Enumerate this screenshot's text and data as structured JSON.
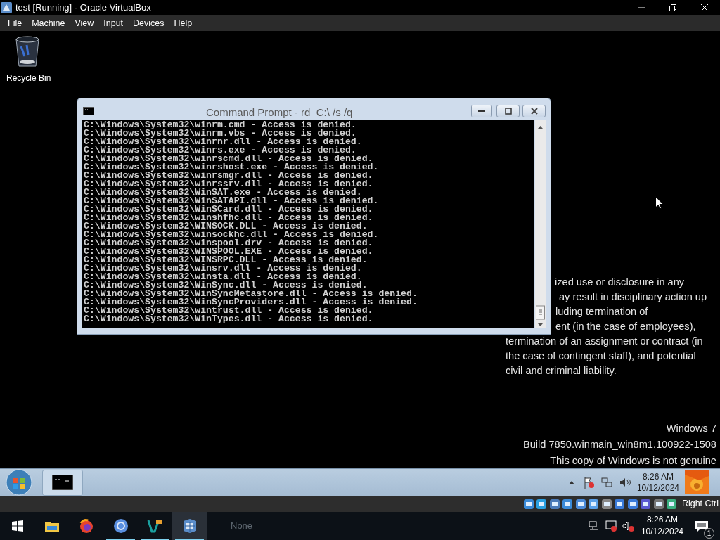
{
  "window": {
    "title": "test [Running] - Oracle VirtualBox"
  },
  "menu": [
    "File",
    "Machine",
    "View",
    "Input",
    "Devices",
    "Help"
  ],
  "desktop": {
    "icons": [
      {
        "label": "Recycle Bin"
      }
    ],
    "console_window": {
      "title": "Command Prompt - rd  C:\\ /s /q",
      "lines": [
        "C:\\Windows\\System32\\winrm.cmd - Access is denied.",
        "C:\\Windows\\System32\\winrm.vbs - Access is denied.",
        "C:\\Windows\\System32\\winrnr.dll - Access is denied.",
        "C:\\Windows\\System32\\winrs.exe - Access is denied.",
        "C:\\Windows\\System32\\winrscmd.dll - Access is denied.",
        "C:\\Windows\\System32\\winrshost.exe - Access is denied.",
        "C:\\Windows\\System32\\winrsmgr.dll - Access is denied.",
        "C:\\Windows\\System32\\winrssrv.dll - Access is denied.",
        "C:\\Windows\\System32\\WinSAT.exe - Access is denied.",
        "C:\\Windows\\System32\\WinSATAPI.dll - Access is denied.",
        "C:\\Windows\\System32\\WinSCard.dll - Access is denied.",
        "C:\\Windows\\System32\\winshfhc.dll - Access is denied.",
        "C:\\Windows\\System32\\WINSOCK.DLL - Access is denied.",
        "C:\\Windows\\System32\\winsockhc.dll - Access is denied.",
        "C:\\Windows\\System32\\winspool.drv - Access is denied.",
        "C:\\Windows\\System32\\WINSPOOL.EXE - Access is denied.",
        "C:\\Windows\\System32\\WINSRPC.DLL - Access is denied.",
        "C:\\Windows\\System32\\winsrv.dll - Access is denied.",
        "C:\\Windows\\System32\\winsta.dll - Access is denied.",
        "C:\\Windows\\System32\\WinSync.dll - Access is denied.",
        "C:\\Windows\\System32\\WinSyncMetastore.dll - Access is denied.",
        "C:\\Windows\\System32\\WinSyncProviders.dll - Access is denied.",
        "C:\\Windows\\System32\\wintrust.dll - Access is denied.",
        "C:\\Windows\\System32\\WinTypes.dll - Access is denied."
      ]
    },
    "notice_lines": [
      "ized use or disclosure in any",
      "ay result in disciplinary action up",
      "luding termination of",
      "ent (in the case of employees),",
      "termination of an assignment or contract (in",
      "the case of contingent staff), and potential",
      "civil and criminal liability."
    ],
    "watermark": [
      "Windows 7",
      "Build 7850.winmain_win8m1.100922-1508",
      "This copy of Windows is not genuine"
    ]
  },
  "guest_taskbar": {
    "apps": [
      {
        "selected": true
      }
    ],
    "clock_time": "8:26 AM",
    "clock_date": "10/12/2024"
  },
  "vm_status": {
    "host_key": "Right Ctrl"
  },
  "host_taskbar": {
    "apps": [
      {
        "running": false,
        "selected": false
      },
      {
        "running": false,
        "selected": false
      },
      {
        "running": false,
        "selected": false
      },
      {
        "running": true,
        "selected": false
      },
      {
        "running": true,
        "selected": false
      },
      {
        "running": true,
        "selected": true
      }
    ],
    "search_hint": "None",
    "clock_time": "8:26 AM",
    "clock_date": "10/12/2024",
    "notification_count": "1"
  }
}
